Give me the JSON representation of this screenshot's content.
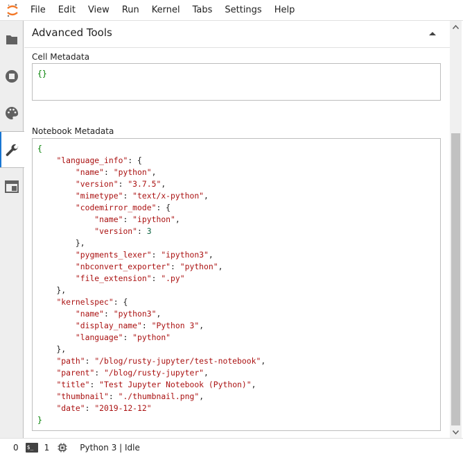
{
  "menu": {
    "items": [
      "File",
      "Edit",
      "View",
      "Run",
      "Kernel",
      "Tabs",
      "Settings",
      "Help"
    ]
  },
  "sidebar": {
    "tabs": [
      {
        "icon": "folder-icon",
        "active": false
      },
      {
        "icon": "stop-circle-icon",
        "active": false
      },
      {
        "icon": "palette-icon",
        "active": false
      },
      {
        "icon": "wrench-icon",
        "active": true
      },
      {
        "icon": "tab-window-icon",
        "active": false
      }
    ]
  },
  "panel": {
    "title": "Advanced Tools",
    "cell_metadata_label": "Cell Metadata",
    "cell_metadata_value": "{}",
    "notebook_metadata_label": "Notebook Metadata",
    "notebook_metadata_lines": [
      [
        [
          "b",
          "{"
        ]
      ],
      [
        [
          "p",
          "    "
        ],
        [
          "k",
          "\"language_info\""
        ],
        [
          "p",
          ": {"
        ]
      ],
      [
        [
          "p",
          "        "
        ],
        [
          "k",
          "\"name\""
        ],
        [
          "p",
          ": "
        ],
        [
          "s",
          "\"python\""
        ],
        [
          "p",
          ","
        ]
      ],
      [
        [
          "p",
          "        "
        ],
        [
          "k",
          "\"version\""
        ],
        [
          "p",
          ": "
        ],
        [
          "s",
          "\"3.7.5\""
        ],
        [
          "p",
          ","
        ]
      ],
      [
        [
          "p",
          "        "
        ],
        [
          "k",
          "\"mimetype\""
        ],
        [
          "p",
          ": "
        ],
        [
          "s",
          "\"text/x-python\""
        ],
        [
          "p",
          ","
        ]
      ],
      [
        [
          "p",
          "        "
        ],
        [
          "k",
          "\"codemirror_mode\""
        ],
        [
          "p",
          ": {"
        ]
      ],
      [
        [
          "p",
          "            "
        ],
        [
          "k",
          "\"name\""
        ],
        [
          "p",
          ": "
        ],
        [
          "s",
          "\"ipython\""
        ],
        [
          "p",
          ","
        ]
      ],
      [
        [
          "p",
          "            "
        ],
        [
          "k",
          "\"version\""
        ],
        [
          "p",
          ": "
        ],
        [
          "n",
          "3"
        ]
      ],
      [
        [
          "p",
          "        },"
        ]
      ],
      [
        [
          "p",
          "        "
        ],
        [
          "k",
          "\"pygments_lexer\""
        ],
        [
          "p",
          ": "
        ],
        [
          "s",
          "\"ipython3\""
        ],
        [
          "p",
          ","
        ]
      ],
      [
        [
          "p",
          "        "
        ],
        [
          "k",
          "\"nbconvert_exporter\""
        ],
        [
          "p",
          ": "
        ],
        [
          "s",
          "\"python\""
        ],
        [
          "p",
          ","
        ]
      ],
      [
        [
          "p",
          "        "
        ],
        [
          "k",
          "\"file_extension\""
        ],
        [
          "p",
          ": "
        ],
        [
          "s",
          "\".py\""
        ]
      ],
      [
        [
          "p",
          "    },"
        ]
      ],
      [
        [
          "p",
          "    "
        ],
        [
          "k",
          "\"kernelspec\""
        ],
        [
          "p",
          ": {"
        ]
      ],
      [
        [
          "p",
          "        "
        ],
        [
          "k",
          "\"name\""
        ],
        [
          "p",
          ": "
        ],
        [
          "s",
          "\"python3\""
        ],
        [
          "p",
          ","
        ]
      ],
      [
        [
          "p",
          "        "
        ],
        [
          "k",
          "\"display_name\""
        ],
        [
          "p",
          ": "
        ],
        [
          "s",
          "\"Python 3\""
        ],
        [
          "p",
          ","
        ]
      ],
      [
        [
          "p",
          "        "
        ],
        [
          "k",
          "\"language\""
        ],
        [
          "p",
          ": "
        ],
        [
          "s",
          "\"python\""
        ]
      ],
      [
        [
          "p",
          "    },"
        ]
      ],
      [
        [
          "p",
          "    "
        ],
        [
          "k",
          "\"path\""
        ],
        [
          "p",
          ": "
        ],
        [
          "s",
          "\"/blog/rusty-jupyter/test-notebook\""
        ],
        [
          "p",
          ","
        ]
      ],
      [
        [
          "p",
          "    "
        ],
        [
          "k",
          "\"parent\""
        ],
        [
          "p",
          ": "
        ],
        [
          "s",
          "\"/blog/rusty-jupyter\""
        ],
        [
          "p",
          ","
        ]
      ],
      [
        [
          "p",
          "    "
        ],
        [
          "k",
          "\"title\""
        ],
        [
          "p",
          ": "
        ],
        [
          "s",
          "\"Test Jupyter Notebook (Python)\""
        ],
        [
          "p",
          ","
        ]
      ],
      [
        [
          "p",
          "    "
        ],
        [
          "k",
          "\"thumbnail\""
        ],
        [
          "p",
          ": "
        ],
        [
          "s",
          "\"./thumbnail.png\""
        ],
        [
          "p",
          ","
        ]
      ],
      [
        [
          "p",
          "    "
        ],
        [
          "k",
          "\"date\""
        ],
        [
          "p",
          ": "
        ],
        [
          "s",
          "\"2019-12-12\""
        ]
      ],
      [
        [
          "b",
          "}"
        ]
      ]
    ]
  },
  "statusbar": {
    "terminals_count": "0",
    "terminal_icon_text": "$_",
    "kernels_count": "1",
    "kernel_status": "Python 3 | Idle"
  },
  "colors": {
    "accent": "#1976d2",
    "json_brace": "#008000",
    "json_string": "#aa1111",
    "json_number": "#116644",
    "logo": "#f37726"
  }
}
